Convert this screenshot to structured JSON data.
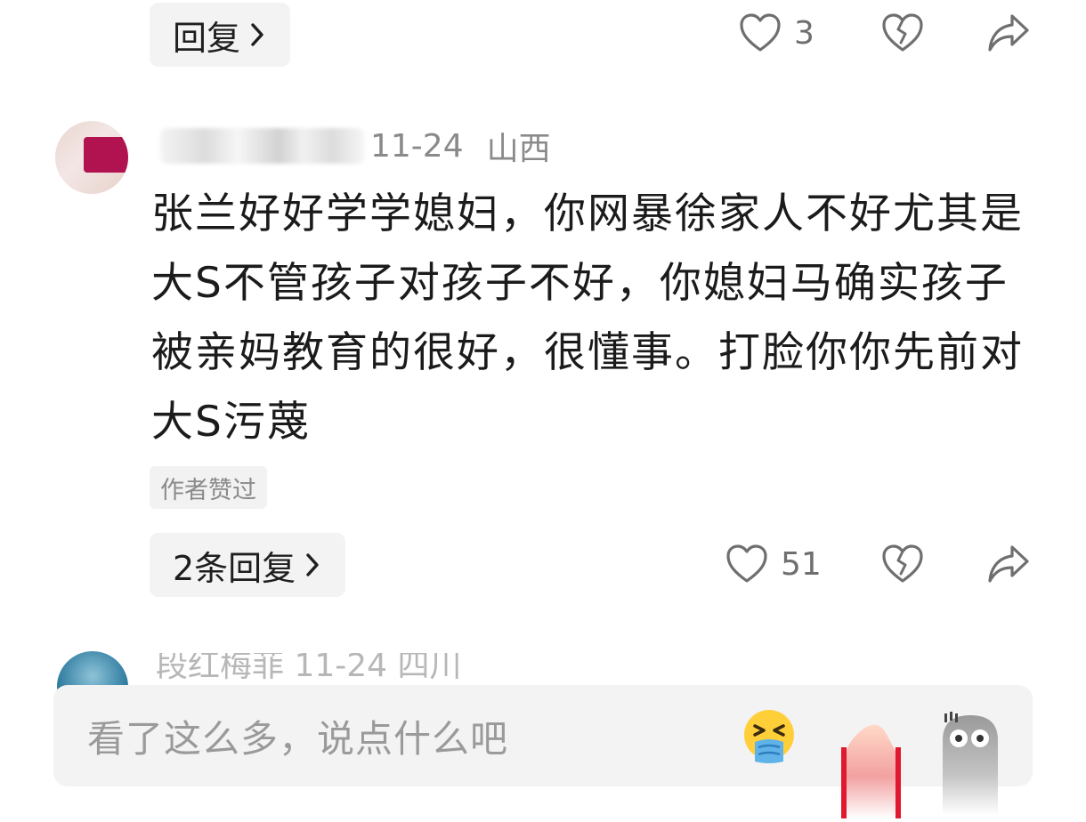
{
  "prev_comment": {
    "reply_label": "回复",
    "like_count": "3"
  },
  "comment": {
    "time": "11-24",
    "location": "山西",
    "text": "张兰好好学学媳妇，你网暴徐家人不好尤其是大S不管孩子对孩子不好，你媳妇马确实孩子被亲妈教育的很好，很懂事。打脸你你先前对大S污蔑",
    "author_liked_tag": "作者赞过",
    "replies_label": "2条回复",
    "like_count": "51"
  },
  "next_comment": {
    "preview": "段红梅菲  11-24  四川"
  },
  "input_bar": {
    "placeholder": "看了这么多，说点什么吧",
    "emojis": [
      "nauseated-face",
      "raised-hand",
      "ghost-face"
    ]
  },
  "colors": {
    "pill_bg": "#f3f3f3",
    "icon": "#6f6f6f",
    "tag_text": "#8a8a8a",
    "avatar_accent": "#b0134f"
  }
}
